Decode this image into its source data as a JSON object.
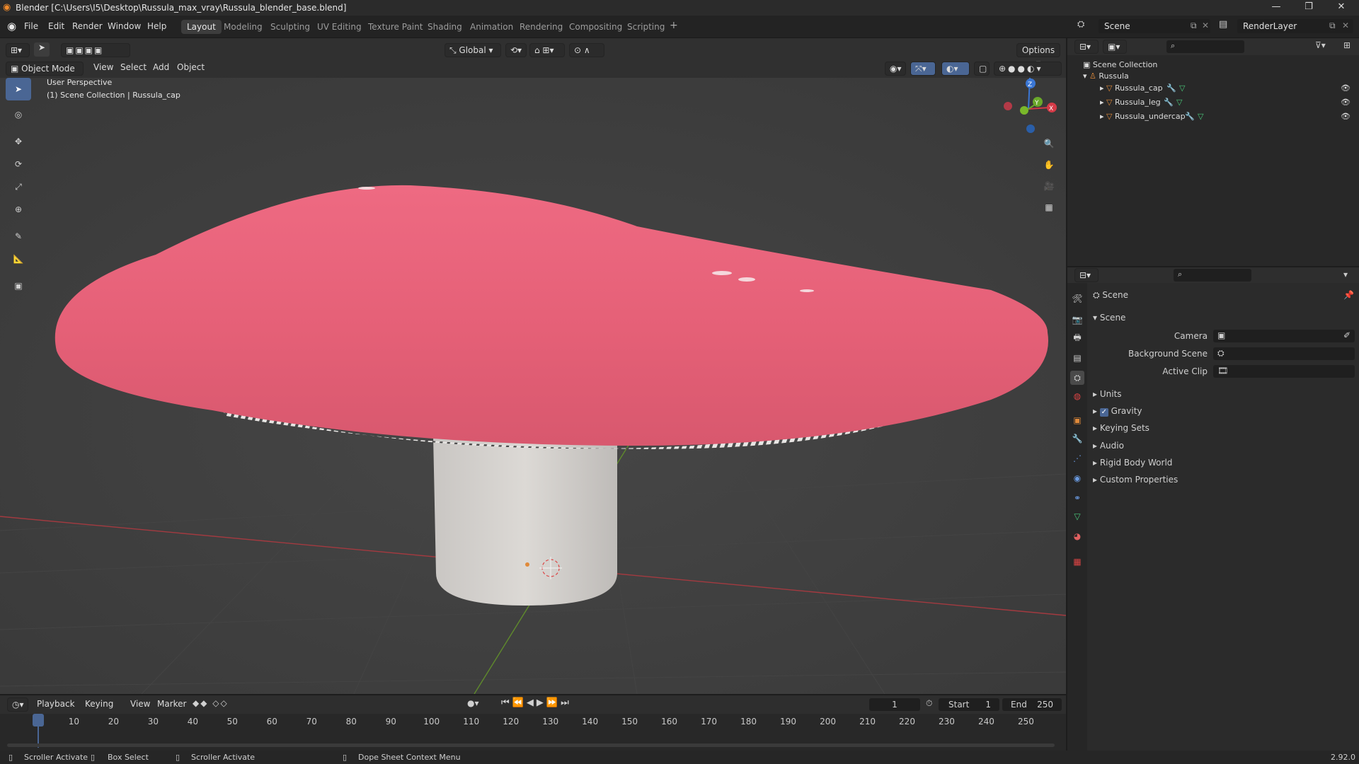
{
  "window": {
    "title": "Blender [C:\\Users\\I5\\Desktop\\Russula_max_vray\\Russula_blender_base.blend]"
  },
  "menu": [
    "File",
    "Edit",
    "Render",
    "Window",
    "Help"
  ],
  "workspaces": [
    "Layout",
    "Modeling",
    "Sculpting",
    "UV Editing",
    "Texture Paint",
    "Shading",
    "Animation",
    "Rendering",
    "Compositing",
    "Scripting"
  ],
  "active_workspace": "Layout",
  "scene_selector": {
    "scene": "Scene",
    "render_layer": "RenderLayer"
  },
  "viewport_header": {
    "transform_orientation": "Global",
    "options": "Options",
    "mode": "Object Mode",
    "menus": [
      "View",
      "Select",
      "Add",
      "Object"
    ]
  },
  "viewport": {
    "perspective": "User Perspective",
    "context": "(1) Scene Collection | Russula_cap"
  },
  "gizmo": {
    "x": "X",
    "y": "Y",
    "z": "Z"
  },
  "outliner": {
    "root": "Scene Collection",
    "collection": "Russula",
    "objects": [
      "Russula_cap",
      "Russula_leg",
      "Russula_undercap"
    ]
  },
  "properties": {
    "header": "Scene",
    "panel": "Scene",
    "camera_label": "Camera",
    "bg_scene_label": "Background Scene",
    "active_clip_label": "Active Clip",
    "sections": [
      "Units",
      "Gravity",
      "Keying Sets",
      "Audio",
      "Rigid Body World",
      "Custom Properties"
    ],
    "gravity_enabled": true
  },
  "timeline": {
    "menus": [
      "Playback",
      "Keying",
      "View",
      "Marker"
    ],
    "current_frame": "1",
    "start_label": "Start",
    "start": "1",
    "end_label": "End",
    "end": "250",
    "ticks": [
      "1",
      "10",
      "20",
      "30",
      "40",
      "50",
      "60",
      "70",
      "80",
      "90",
      "100",
      "110",
      "120",
      "130",
      "140",
      "150",
      "160",
      "170",
      "180",
      "190",
      "200",
      "210",
      "220",
      "230",
      "240",
      "250"
    ]
  },
  "statusbar": {
    "left1": "Scroller Activate",
    "left2": "Box Select",
    "left3": "Scroller Activate",
    "context": "Dope Sheet Context Menu",
    "version": "2.92.0"
  },
  "colors": {
    "accent": "#4a6694",
    "cap": "#e8687e",
    "stem": "#d4d0cc",
    "x_axis": "#d43a47",
    "y_axis": "#6aa82a",
    "z_axis": "#3a76d4"
  }
}
